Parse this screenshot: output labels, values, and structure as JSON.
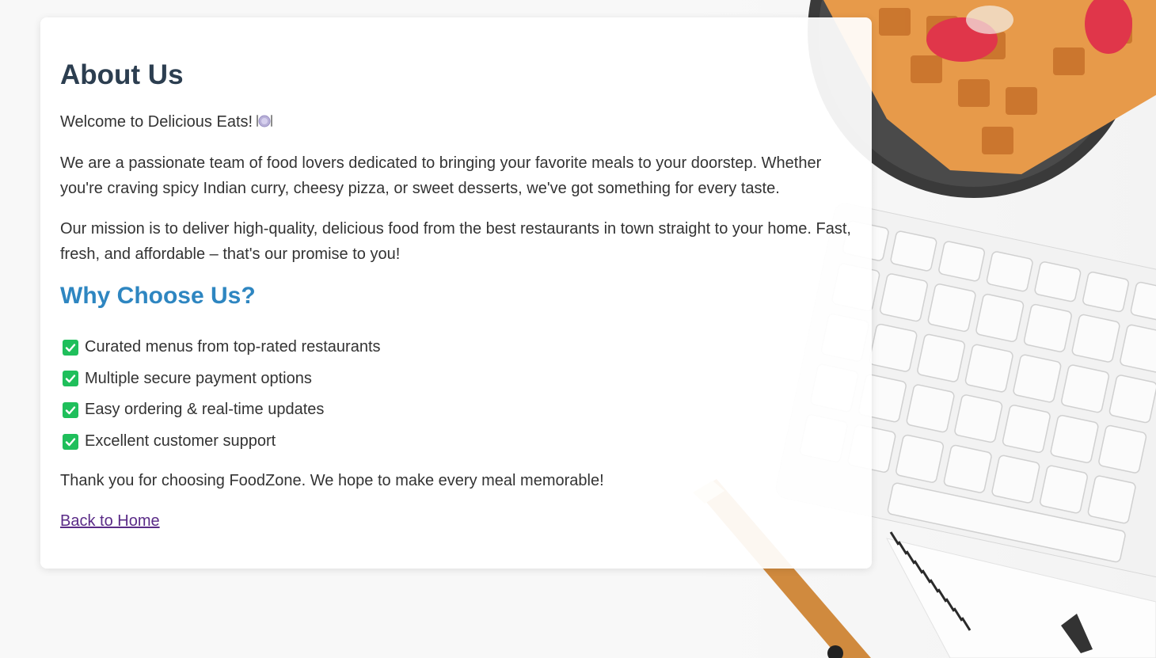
{
  "about": {
    "title": "About Us",
    "welcome": "Welcome to Delicious Eats!",
    "welcome_icon": "plate-cutlery-icon",
    "paragraph1": "We are a passionate team of food lovers dedicated to bringing your favorite meals to your doorstep. Whether you're craving spicy Indian curry, cheesy pizza, or sweet desserts, we've got something for every taste.",
    "paragraph2": "Our mission is to deliver high-quality, delicious food from the best restaurants in town straight to your home. Fast, fresh, and affordable – that's our promise to you!",
    "why_title": "Why Choose Us?",
    "features": [
      {
        "text": "Curated menus from top-rated restaurants",
        "icon": "check-mark-icon"
      },
      {
        "text": "Multiple secure payment options",
        "icon": "check-mark-icon"
      },
      {
        "text": "Easy ordering & real-time updates",
        "icon": "check-mark-icon"
      },
      {
        "text": "Excellent customer support",
        "icon": "check-mark-icon"
      }
    ],
    "thanks": "Thank you for choosing FoodZone. We hope to make every meal memorable!",
    "back_link": "Back to Home"
  },
  "colors": {
    "heading": "#2c3e50",
    "subheading": "#2e86c1",
    "check": "#1fbf5b",
    "link_visited": "#5a2b87"
  }
}
